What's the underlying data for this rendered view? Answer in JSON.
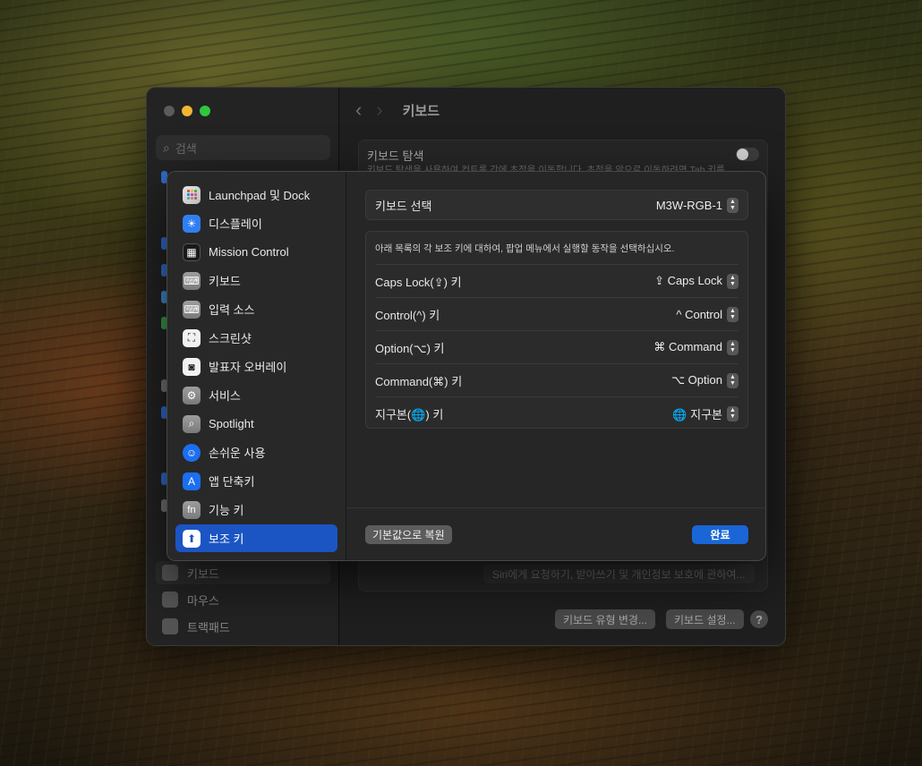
{
  "window": {
    "title": "키보드",
    "search_placeholder": "검색",
    "keyboard_nav_title": "키보드 탐색",
    "keyboard_nav_desc": "키보드 탐색을 사용하여 컨트롤 간에 초점을 이동합니다. 초점을 앞으로 이동하려면 Tab 키를",
    "siri_button": "Siri에게 요청하기, 받아쓰기 및 개인정보 보호에 관하여...",
    "change_type_button": "키보드 유형 변경...",
    "setup_button": "키보드 설정...",
    "help_label": "?",
    "sidebar_bottom": [
      {
        "label": "키보드",
        "icon": "keyboard-icon"
      },
      {
        "label": "마우스",
        "icon": "mouse-icon"
      },
      {
        "label": "트랙패드",
        "icon": "trackpad-icon"
      }
    ]
  },
  "sheet": {
    "sidebar": [
      {
        "label": "Launchpad 및 Dock",
        "icon": "launchpad-icon"
      },
      {
        "label": "디스플레이",
        "icon": "display-brightness-icon"
      },
      {
        "label": "Mission Control",
        "icon": "mission-control-icon"
      },
      {
        "label": "키보드",
        "icon": "keyboard-icon"
      },
      {
        "label": "입력 소스",
        "icon": "input-source-icon"
      },
      {
        "label": "스크린샷",
        "icon": "screenshot-icon"
      },
      {
        "label": "발표자 오버레이",
        "icon": "presenter-overlay-icon"
      },
      {
        "label": "서비스",
        "icon": "services-gear-icon"
      },
      {
        "label": "Spotlight",
        "icon": "spotlight-search-icon"
      },
      {
        "label": "손쉬운 사용",
        "icon": "accessibility-icon"
      },
      {
        "label": "앱 단축키",
        "icon": "app-shortcuts-icon"
      },
      {
        "label": "기능 키",
        "icon": "fn-key-icon"
      },
      {
        "label": "보조 키",
        "icon": "modifier-keys-icon"
      }
    ],
    "selected_sidebar": "보조 키",
    "keyboard_select_label": "키보드 선택",
    "keyboard_select_value": "M3W-RGB-1",
    "modifier_desc": "아래 목록의 각 보조 키에 대하여, 팝업 메뉴에서 실행할 동작을 선택하십시오.",
    "modifiers": [
      {
        "key": "Caps Lock(⇪) 키",
        "action": "⇪ Caps Lock"
      },
      {
        "key": "Control(^) 키",
        "action": "^ Control"
      },
      {
        "key": "Option(⌥) 키",
        "action": "⌘ Command"
      },
      {
        "key": "Command(⌘) 키",
        "action": "⌥ Option"
      },
      {
        "key": "지구본(🌐) 키",
        "action": "🌐 지구본"
      }
    ],
    "restore_button": "기본값으로 복원",
    "done_button": "완료"
  },
  "colors": {
    "accent": "#1b55c3",
    "done_button": "#1a66d6",
    "traffic_min": "#f2b632",
    "traffic_max": "#2ec840"
  }
}
